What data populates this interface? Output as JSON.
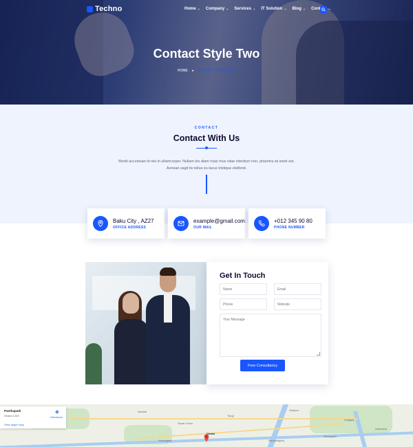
{
  "brand": {
    "name": "Techno"
  },
  "nav": {
    "items": [
      {
        "label": "Home"
      },
      {
        "label": "Company"
      },
      {
        "label": "Services"
      },
      {
        "label": "IT Solution"
      },
      {
        "label": "Blog"
      },
      {
        "label": "Contact"
      }
    ],
    "search_icon": "search-icon"
  },
  "hero": {
    "title": "Contact Style Two",
    "breadcrumb": {
      "home": "HOME",
      "separator": "▸",
      "current": "CONTACT STYLE TWO"
    }
  },
  "contact_section": {
    "eyebrow": "CONTACT",
    "title": "Contact With Us",
    "description": "Morbi accumsan id nisi in ullamcorper. Nullam leo diam maxi mus vitae interdum non, pharetra sit amet est. Aenean sagit tis tellus eu lacus tristique eleifend."
  },
  "info_cards": [
    {
      "icon": "location-pin-icon",
      "main": "Baku City , AZ27",
      "sub": "OFFICE ADDRESS"
    },
    {
      "icon": "envelope-icon",
      "main": "example@gmail.com",
      "sub": "OUR MAIL"
    },
    {
      "icon": "phone-icon",
      "main": "+012 345 90 80",
      "sub": "PHONE NUMBER"
    }
  ],
  "form": {
    "title": "Get In Touch",
    "placeholders": {
      "name": "Name",
      "email": "Email",
      "phone": "Phone",
      "website": "Website",
      "message": "Your Message"
    },
    "submit_label": "Free Consultancy"
  },
  "map": {
    "place": "Panthapath",
    "address": "Dhaka 1205",
    "directions": "Directions",
    "larger_map": "View larger map",
    "labels": [
      "Savar Union",
      "Dhaka",
      "Tongi",
      "Narayanganj",
      "Gazipur",
      "Keraniganj",
      "Sonargaon",
      "Ashulia",
      "Kaliganj",
      "Araihazar"
    ]
  },
  "colors": {
    "accent": "#1a56ff",
    "heading": "#0b0b31",
    "section_bg": "#eef3fd"
  }
}
